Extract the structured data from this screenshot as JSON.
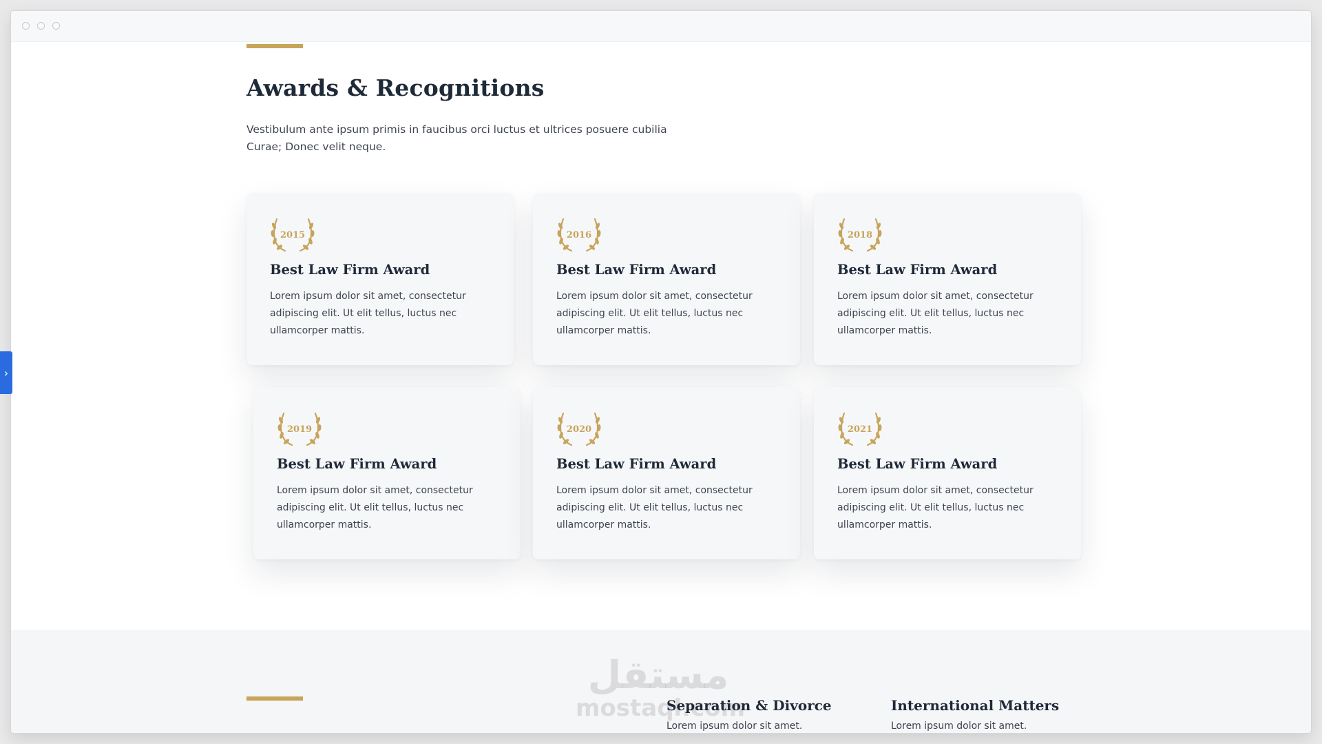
{
  "awards_section": {
    "title": "Awards & Recognitions",
    "subtitle": "Vestibulum ante ipsum primis in faucibus orci luctus et ultrices posuere cubilia Curae; Donec velit neque."
  },
  "awards": [
    {
      "year": "2015",
      "title": "Best Law Firm Award",
      "text": "Lorem ipsum dolor sit amet, consectetur adipiscing elit. Ut elit tellus, luctus nec ullamcorper mattis."
    },
    {
      "year": "2016",
      "title": "Best Law Firm Award",
      "text": "Lorem ipsum dolor sit amet, consectetur adipiscing elit. Ut elit tellus, luctus nec ullamcorper mattis."
    },
    {
      "year": "2018",
      "title": "Best Law Firm Award",
      "text": "Lorem ipsum dolor sit amet, consectetur adipiscing elit. Ut elit tellus, luctus nec ullamcorper mattis."
    },
    {
      "year": "2019",
      "title": "Best Law Firm Award",
      "text": "Lorem ipsum dolor sit amet, consectetur adipiscing elit. Ut elit tellus, luctus nec ullamcorper mattis."
    },
    {
      "year": "2020",
      "title": "Best Law Firm Award",
      "text": "Lorem ipsum dolor sit amet, consectetur adipiscing elit. Ut elit tellus, luctus nec ullamcorper mattis."
    },
    {
      "year": "2021",
      "title": "Best Law Firm Award",
      "text": "Lorem ipsum dolor sit amet, consectetur adipiscing elit. Ut elit tellus, luctus nec ullamcorper mattis."
    }
  ],
  "services_preview": [
    {
      "title": "Separation & Divorce",
      "text": "Lorem ipsum dolor sit amet."
    },
    {
      "title": "International Matters",
      "text": "Lorem ipsum dolor sit amet."
    }
  ],
  "watermark": {
    "arabic": "مستقل",
    "latin": "mostaql.com"
  },
  "sidebar_toggle": {
    "icon": "chevron-right-icon",
    "glyph": "›"
  },
  "colors": {
    "accent": "#c8a45a",
    "heading": "#1f2a38",
    "body_text": "#3d4450",
    "card_bg": "#f6f7f9",
    "toggle": "#2b6be0"
  }
}
